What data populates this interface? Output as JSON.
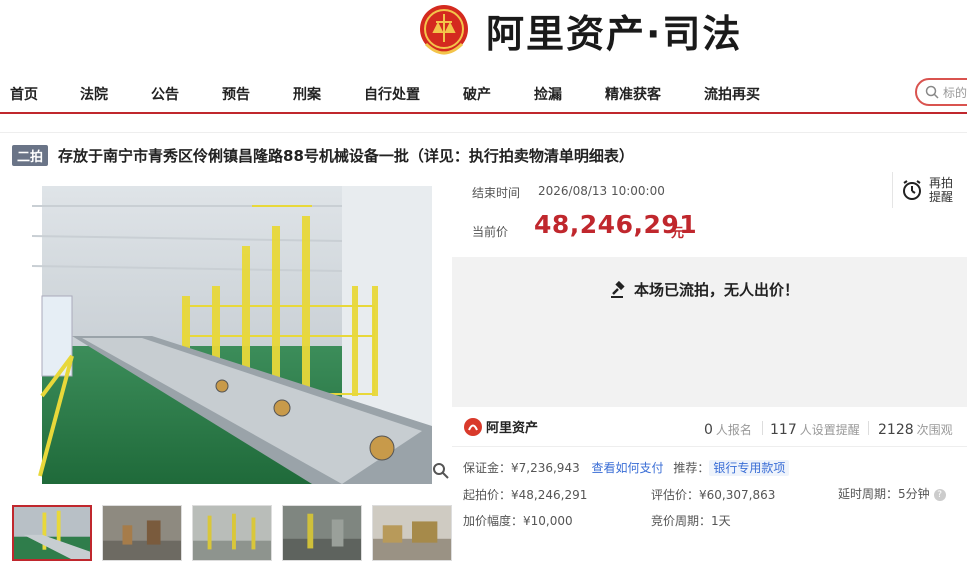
{
  "header": {
    "brand": "阿里资产·司法"
  },
  "nav": {
    "items": [
      "首页",
      "法院",
      "公告",
      "预告",
      "刑案",
      "自行处置",
      "破产",
      "捡漏",
      "精准获客",
      "流拍再买"
    ],
    "search_placeholder": "标的"
  },
  "lot": {
    "badge": "二拍",
    "title": "存放于南宁市青秀区伶俐镇昌隆路88号机械设备一批（详见：执行拍卖物清单明细表）"
  },
  "auction": {
    "end_label": "结束时间",
    "end_value": "2026/08/13 10:00:00",
    "price_label": "当前价",
    "price_value": "48,246,291",
    "price_unit": "元",
    "remind_label": "再拍提醒",
    "status_text": "本场已流拍，无人出价！"
  },
  "stats": {
    "logo_text": "阿里资产",
    "signups": "0",
    "signups_label": "人报名",
    "reminders": "117",
    "reminders_label": "人设置提醒",
    "views": "2128",
    "views_label": "次围观"
  },
  "details": {
    "deposit": "保证金：¥7,236,943",
    "how_to_pay": "查看如何支付",
    "recommend_label": "推荐：",
    "recommend_tag": "银行专用款项",
    "start_price": "起拍价：¥48,246,291",
    "appraisal": "评估价：¥60,307,863",
    "delay": "延时周期：5分钟",
    "increment": "加价幅度：¥10,000",
    "bid_cycle": "竞价周期：1天"
  },
  "colors": {
    "accent": "#c0272d",
    "badge_bg": "#6a7487",
    "link": "#3a6ed6"
  }
}
